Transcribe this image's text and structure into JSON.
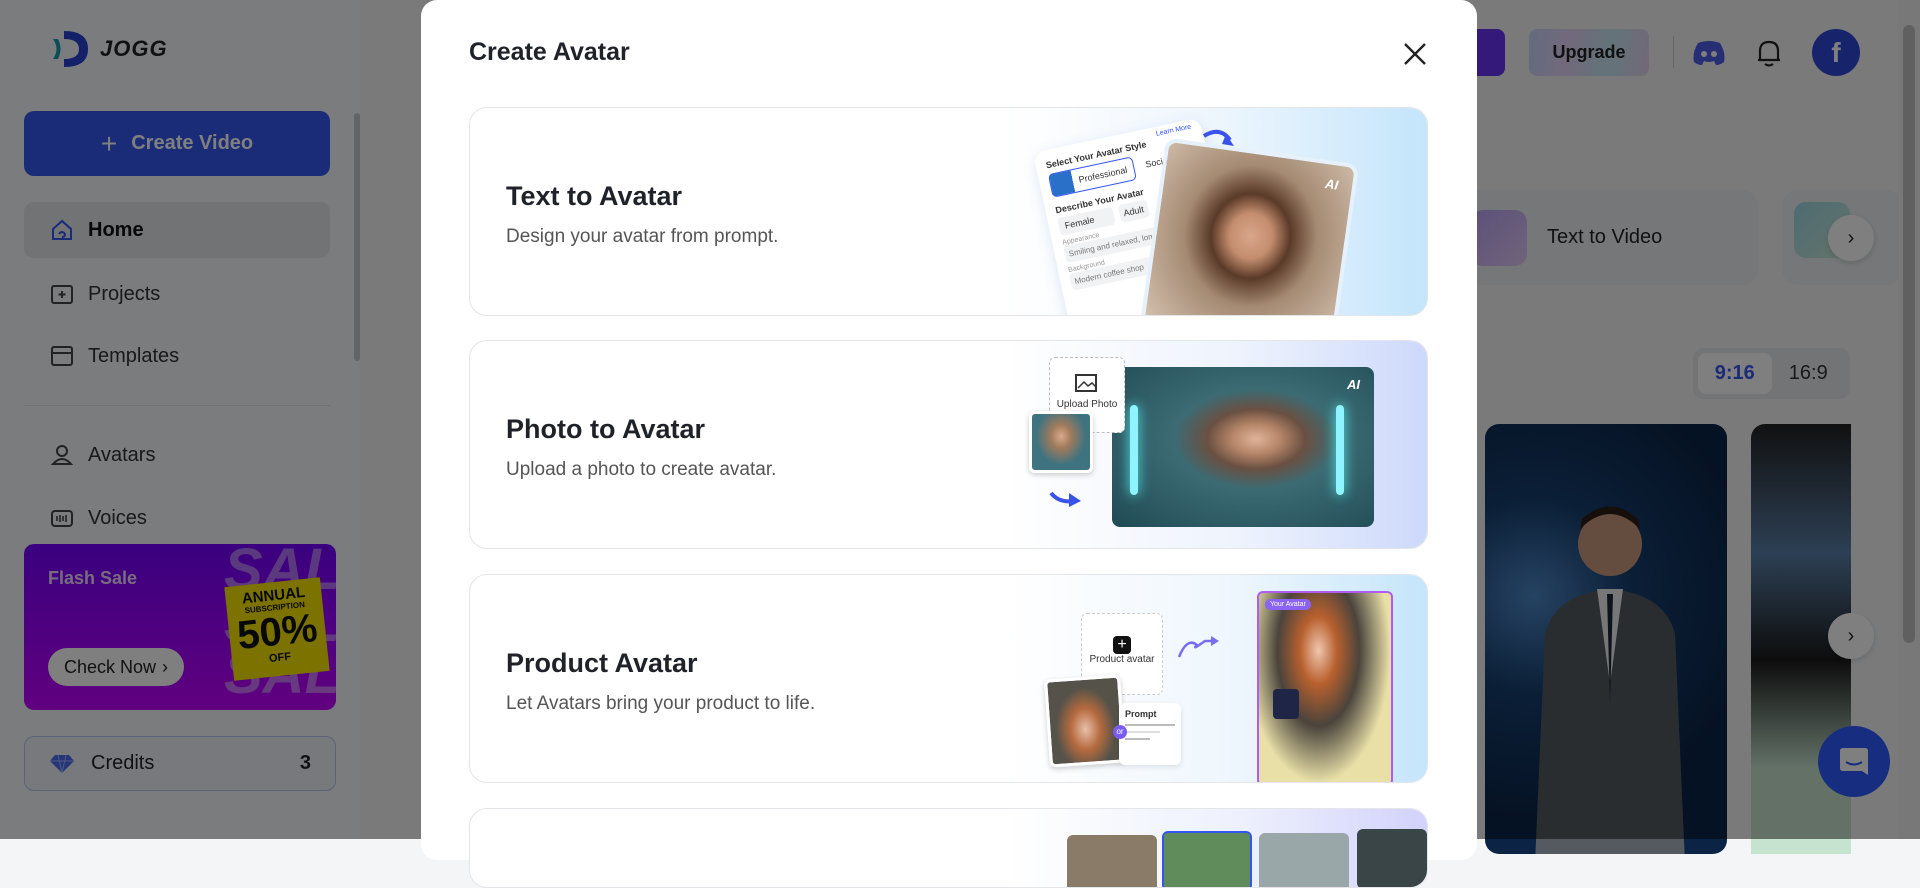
{
  "brand": {
    "name": "JOGG"
  },
  "sidebar": {
    "create_label": "Create Video",
    "items": [
      {
        "label": "Home",
        "icon": "home-icon"
      },
      {
        "label": "Projects",
        "icon": "projects-icon"
      },
      {
        "label": "Templates",
        "icon": "templates-icon"
      },
      {
        "label": "Avatars",
        "icon": "avatar-icon"
      },
      {
        "label": "Voices",
        "icon": "voices-icon"
      }
    ],
    "banner": {
      "title": "Flash Sale",
      "button": "Check Now",
      "sale": "SALE",
      "annual": "ANNUAL",
      "subscription": "SUBSCRIPTION",
      "percent": "50%",
      "off": "OFF"
    },
    "credits": {
      "label": "Credits",
      "value": "3"
    }
  },
  "header": {
    "upgrade": "Upgrade",
    "avatar_letter": "f"
  },
  "main": {
    "feature": "Text to Video",
    "ratio_tabs": [
      "9:16",
      "16:9"
    ],
    "active_ratio": "9:16"
  },
  "modal": {
    "title": "Create Avatar",
    "cards": [
      {
        "title": "Text to Avatar",
        "subtitle": "Design your avatar from prompt."
      },
      {
        "title": "Photo to Avatar",
        "subtitle": "Upload a photo to create avatar."
      },
      {
        "title": "Product Avatar",
        "subtitle": "Let Avatars bring your product to life."
      }
    ],
    "art": {
      "style_title": "Select Your Avatar Style",
      "learn_more": "Learn More",
      "professional": "Professional",
      "social": "Social",
      "describe": "Describe Your Avatar",
      "female": "Female",
      "adult": "Adult",
      "appearance": "Appearance",
      "appearance_value": "Smiling and relaxed, long stra",
      "background": "Background",
      "background_value": "Modern coffee shop",
      "ai": "AI",
      "upload_photo": "Upload Photo",
      "product_avatar": "Product avatar",
      "prompt": "Prompt",
      "or": "or",
      "your_avatar": "Your Avatar"
    }
  }
}
